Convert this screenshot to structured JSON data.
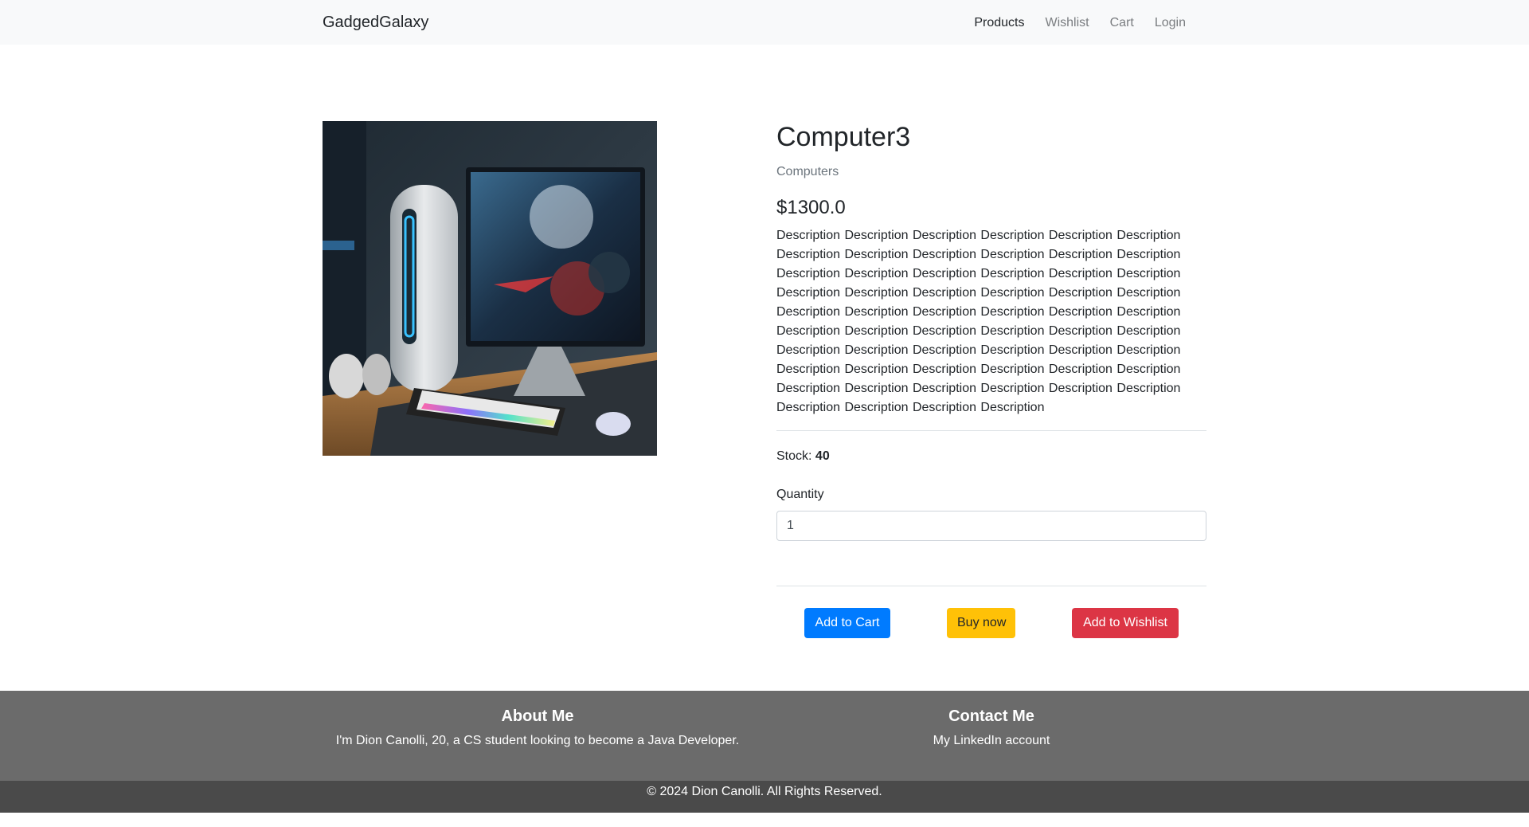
{
  "navbar": {
    "brand": "GadgedGalaxy",
    "links": [
      "Products",
      "Wishlist",
      "Cart",
      "Login"
    ]
  },
  "product": {
    "image_alt": "computer-desk-setup",
    "title": "Computer3",
    "category": "Computers",
    "price": "$1300.0",
    "description": "Description Description Description Description Description Description Description Description Description Description Description Description Description Description Description Description Description Description Description Description Description Description Description Description Description Description Description Description Description Description Description Description Description Description Description Description Description Description Description Description Description Description Description Description Description Description Description Description Description Description Description Description Description Description Description Description Description Description",
    "stock_label": "Stock:",
    "stock_value": "40",
    "quantity_label": "Quantity",
    "quantity_value": "1"
  },
  "actions": {
    "add_to_cart": "Add to Cart",
    "buy_now": "Buy now",
    "add_to_wishlist": "Add to Wishlist"
  },
  "colors": {
    "primary": "#007bff",
    "warning": "#ffc107",
    "danger": "#dc3545",
    "footer": "#6b6b6b",
    "footer_bottom": "#4a4a4a"
  },
  "footer": {
    "about_title": "About Me",
    "about_text": "I'm Dion Canolli, 20, a CS student looking to become a Java Developer.",
    "contact_title": "Contact Me",
    "contact_link": "My LinkedIn account",
    "copyright": "© 2024 Dion Canolli. All Rights Reserved."
  }
}
